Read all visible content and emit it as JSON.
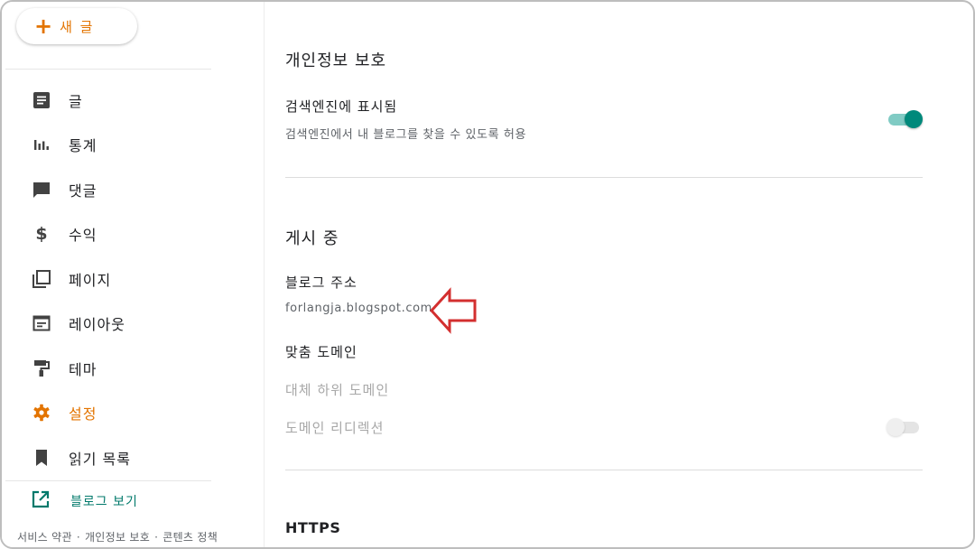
{
  "sidebar": {
    "new_post_label": "새 글",
    "items": [
      {
        "label": "글",
        "icon": "posts-icon"
      },
      {
        "label": "통계",
        "icon": "stats-icon"
      },
      {
        "label": "댓글",
        "icon": "comment-icon"
      },
      {
        "label": "수익",
        "icon": "dollar-icon"
      },
      {
        "label": "페이지",
        "icon": "pages-icon"
      },
      {
        "label": "레이아웃",
        "icon": "layout-icon"
      },
      {
        "label": "테마",
        "icon": "theme-roller-icon"
      },
      {
        "label": "설정",
        "icon": "gear-icon",
        "active": true
      },
      {
        "label": "읽기 목록",
        "icon": "bookmark-icon"
      }
    ],
    "view_blog_label": "블로그 보기",
    "footer": {
      "terms": "서비스 약관",
      "privacy": "개인정보 보호",
      "content_policy": "콘텐츠 정책",
      "separator": "·"
    }
  },
  "main": {
    "privacy_section": {
      "title": "개인정보 보호",
      "search_visible": {
        "title": "검색엔진에 표시됨",
        "description": "검색엔진에서 내 블로그를 찾을 수 있도록 허용",
        "enabled": true
      }
    },
    "publishing_section": {
      "title": "게시 중",
      "blog_address": {
        "title": "블로그 주소",
        "value": "forlangja.blogspot.com"
      },
      "custom_domain": {
        "title": "맞춤 도메인"
      },
      "fallback_subdomain": {
        "title": "대체 하위 도메인"
      },
      "domain_redirect": {
        "title": "도메인 리디렉션",
        "enabled": false
      }
    },
    "https_section": {
      "title": "HTTPS"
    }
  },
  "colors": {
    "accent": "#e37400",
    "toggle_on": "#00897b",
    "link": "#00796b",
    "annotation_arrow": "#d32f2f"
  }
}
